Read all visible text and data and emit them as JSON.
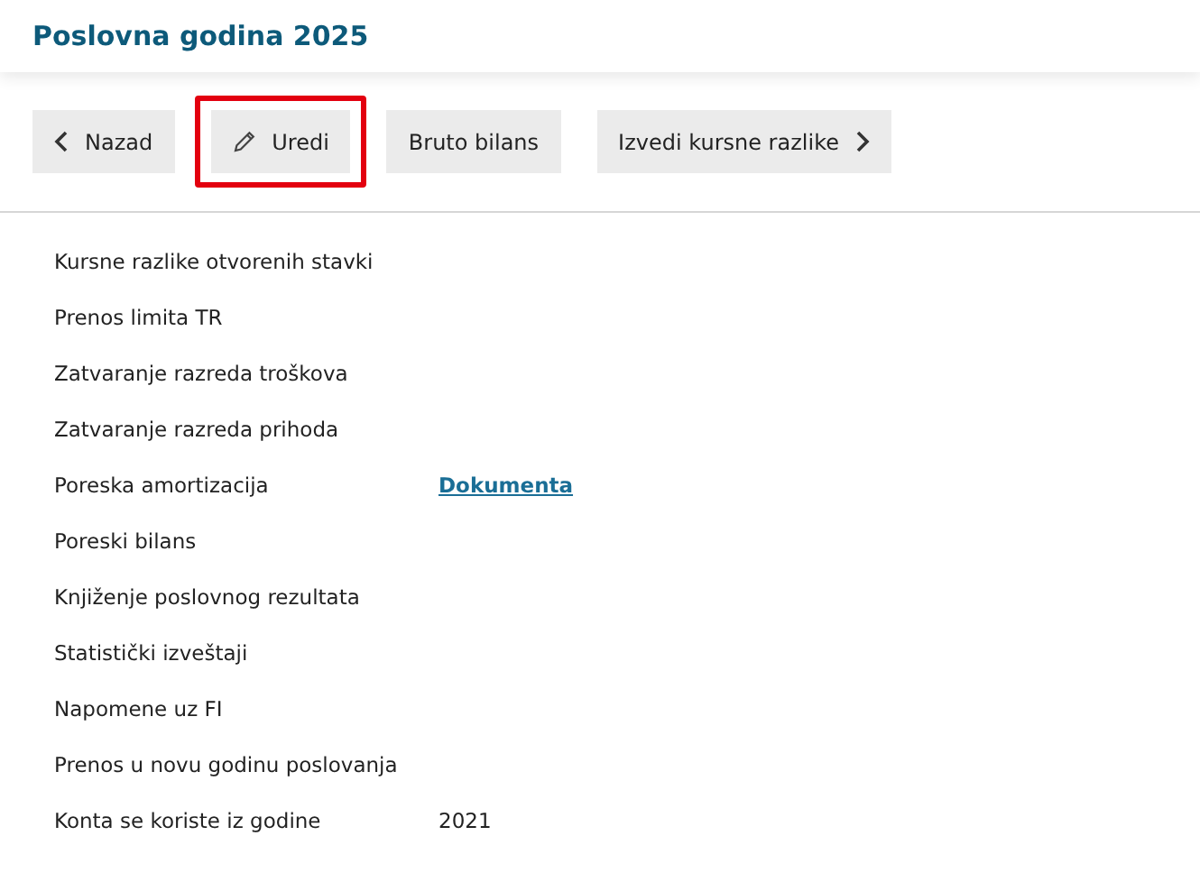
{
  "header": {
    "title": "Poslovna godina 2025"
  },
  "toolbar": [
    {
      "label": "Nazad",
      "kind": "back",
      "highlighted": false
    },
    {
      "label": "Uredi",
      "kind": "edit",
      "highlighted": true
    },
    {
      "label": "Bruto bilans",
      "kind": "plain",
      "highlighted": false
    },
    {
      "label": "Izvedi kursne razlike",
      "kind": "next",
      "highlighted": false
    }
  ],
  "rows": [
    {
      "label": "Kursne razlike otvorenih stavki"
    },
    {
      "label": "Prenos limita TR"
    },
    {
      "label": "Zatvaranje razreda troškova"
    },
    {
      "label": "Zatvaranje razreda prihoda"
    },
    {
      "label": "Poreska amortizacija",
      "value": {
        "kind": "link",
        "text": "Dokumenta"
      }
    },
    {
      "label": "Poreski bilans"
    },
    {
      "label": "Knjiženje poslovnog rezultata"
    },
    {
      "label": "Statistički izveštaji"
    },
    {
      "label": "Napomene uz FI"
    },
    {
      "label": "Prenos u novu godinu poslovanja"
    },
    {
      "label": "Konta se koriste iz godine",
      "value": {
        "kind": "text",
        "text": "2021"
      }
    }
  ]
}
